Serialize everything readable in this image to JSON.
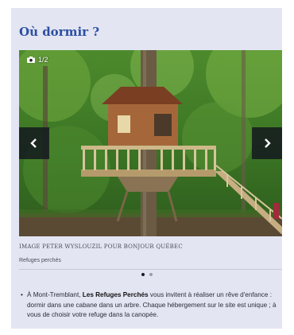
{
  "section": {
    "title": "Où dormir ?"
  },
  "carousel": {
    "counter": "1/2",
    "photo_credit": "IMAGE PETER WYSLOUZIL POUR BONJOUR QUÉBEC",
    "caption": "Refuges perchés",
    "total_slides": 2,
    "active_slide": 1
  },
  "body": {
    "bullet": "•",
    "text_before": "À Mont-Tremblant, ",
    "text_bold": "Les Refuges Perchés",
    "text_after": " vous invitent à réaliser un rêve d'enfance : dormir dans une cabane dans un arbre. Chaque hébergement sur le site est unique ; à vous de choisir votre refuge dans la canopée."
  },
  "colors": {
    "card_bg": "#e3e5f2",
    "title": "#2c4fa3",
    "nav_bg": "#14191e"
  }
}
